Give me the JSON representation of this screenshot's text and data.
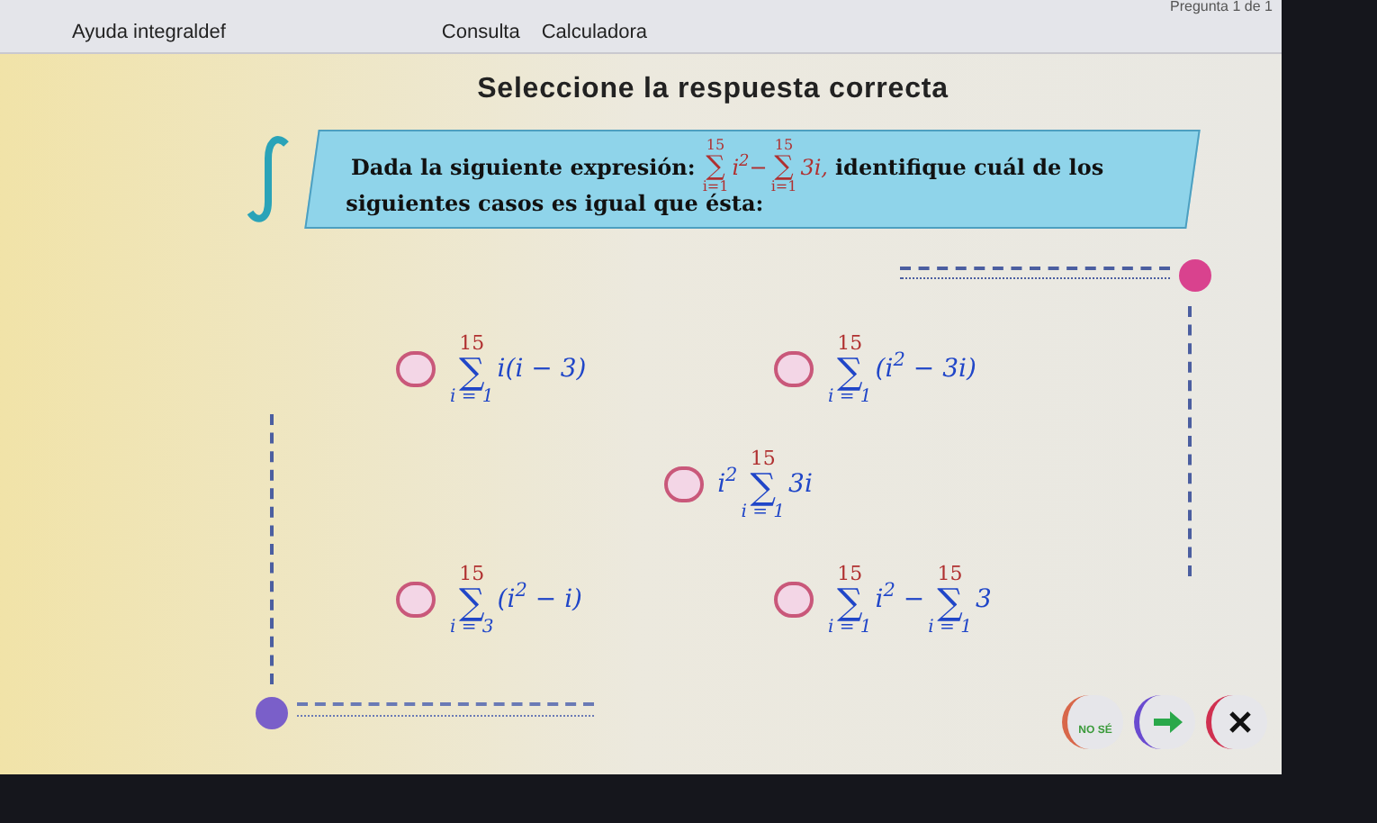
{
  "window": {
    "title": "Pregunta 1 de 1"
  },
  "menu": [
    {
      "label": "Ayuda integraldef"
    },
    {
      "label": "Consulta"
    },
    {
      "label": "Calculadora"
    }
  ],
  "heading": "Seleccione la respuesta correcta",
  "question": {
    "before": "Dada la siguiente expresión:",
    "parts": [
      {
        "kind": "sum",
        "symbol": "∑",
        "upper": "15",
        "lower": "i=1"
      },
      {
        "kind": "text",
        "text": "i$^{2}$−"
      },
      {
        "kind": "sum",
        "symbol": "∑",
        "upper": "15",
        "lower": "i=1"
      },
      {
        "kind": "text",
        "text": "3i,"
      }
    ],
    "after": "identifique cuál de los",
    "line2": "siguientes casos es igual que ésta:"
  },
  "options": [
    {
      "selected": false,
      "parts": [
        {
          "kind": "sum",
          "symbol": "∑",
          "upper": "15",
          "lower": "i = 1"
        },
        {
          "kind": "text",
          "text": "i(i − 3)"
        }
      ]
    },
    {
      "selected": false,
      "parts": [
        {
          "kind": "sum",
          "symbol": "∑",
          "upper": "15",
          "lower": "i = 1"
        },
        {
          "kind": "text",
          "text": "(i$^{2}$ − 3i)"
        }
      ]
    },
    {
      "selected": false,
      "parts": [
        {
          "kind": "text",
          "text": "i$^{2}$"
        },
        {
          "kind": "sum",
          "symbol": "∑",
          "upper": "15",
          "lower": "i = 1"
        },
        {
          "kind": "text",
          "text": "3i"
        }
      ]
    },
    {
      "selected": false,
      "parts": [
        {
          "kind": "sum",
          "symbol": "∑",
          "upper": "15",
          "lower": "i = 3"
        },
        {
          "kind": "text",
          "text": "(i$^{2}$ − i)"
        }
      ]
    },
    {
      "selected": false,
      "parts": [
        {
          "kind": "sum",
          "symbol": "∑",
          "upper": "15",
          "lower": "i = 1"
        },
        {
          "kind": "text",
          "text": "i$^{2}$ −"
        },
        {
          "kind": "sum",
          "symbol": "∑",
          "upper": "15",
          "lower": "i = 1"
        },
        {
          "kind": "text",
          "text": "3"
        }
      ]
    }
  ],
  "buttons": [
    {
      "kind": "dont_know",
      "label": "NO SÉ"
    },
    {
      "kind": "next"
    },
    {
      "kind": "cancel"
    }
  ]
}
